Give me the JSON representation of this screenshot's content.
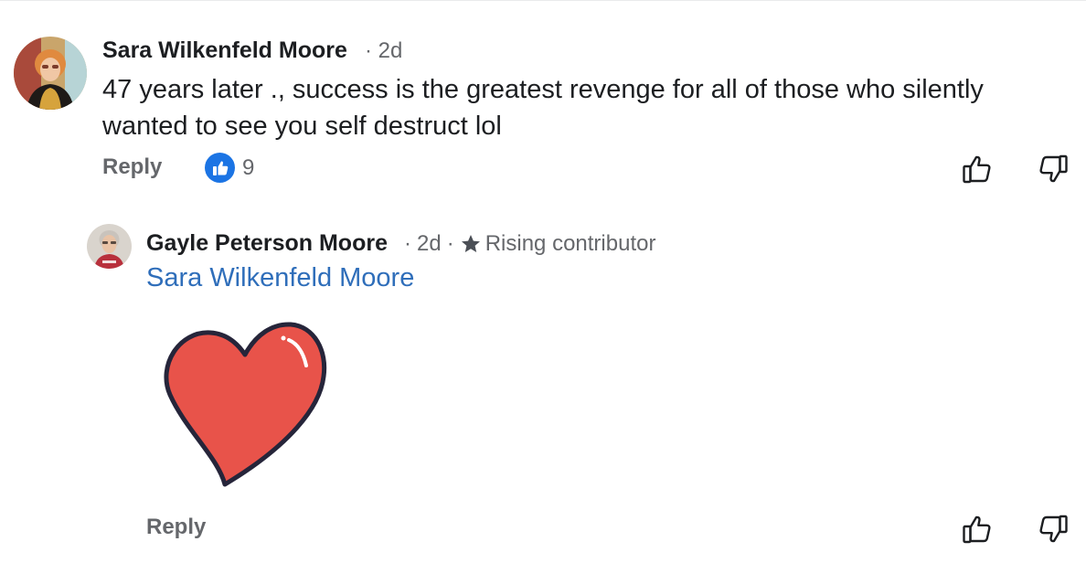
{
  "comments": [
    {
      "author": "Sara Wilkenfeld Moore",
      "meta_separator": "·",
      "age": "2d",
      "text": "47 years later ., success is the greatest revenge for all of those who silently wanted to see you self destruct lol",
      "reply_label": "Reply",
      "reaction": {
        "icon": "thumbs-up-reaction-icon",
        "count": "9"
      },
      "vote_icons": [
        "thumbs-up-outline-icon",
        "thumbs-down-outline-icon"
      ]
    }
  ],
  "replies": [
    {
      "author": "Gayle Peterson Moore",
      "meta_separator": "·",
      "age": "2d",
      "badge_icon": "star-icon",
      "badge_label": "Rising contributor",
      "mention": "Sara Wilkenfeld Moore",
      "sticker_icon": "red-heart-sticker",
      "reply_label": "Reply",
      "vote_icons": [
        "thumbs-up-outline-icon",
        "thumbs-down-outline-icon"
      ]
    }
  ],
  "colors": {
    "text_primary": "#1c1e21",
    "text_secondary": "#65676b",
    "mention_blue": "#2f6eba",
    "reaction_blue": "#1b74e4",
    "heart_red": "#e8534a",
    "heart_outline": "#26253a"
  }
}
